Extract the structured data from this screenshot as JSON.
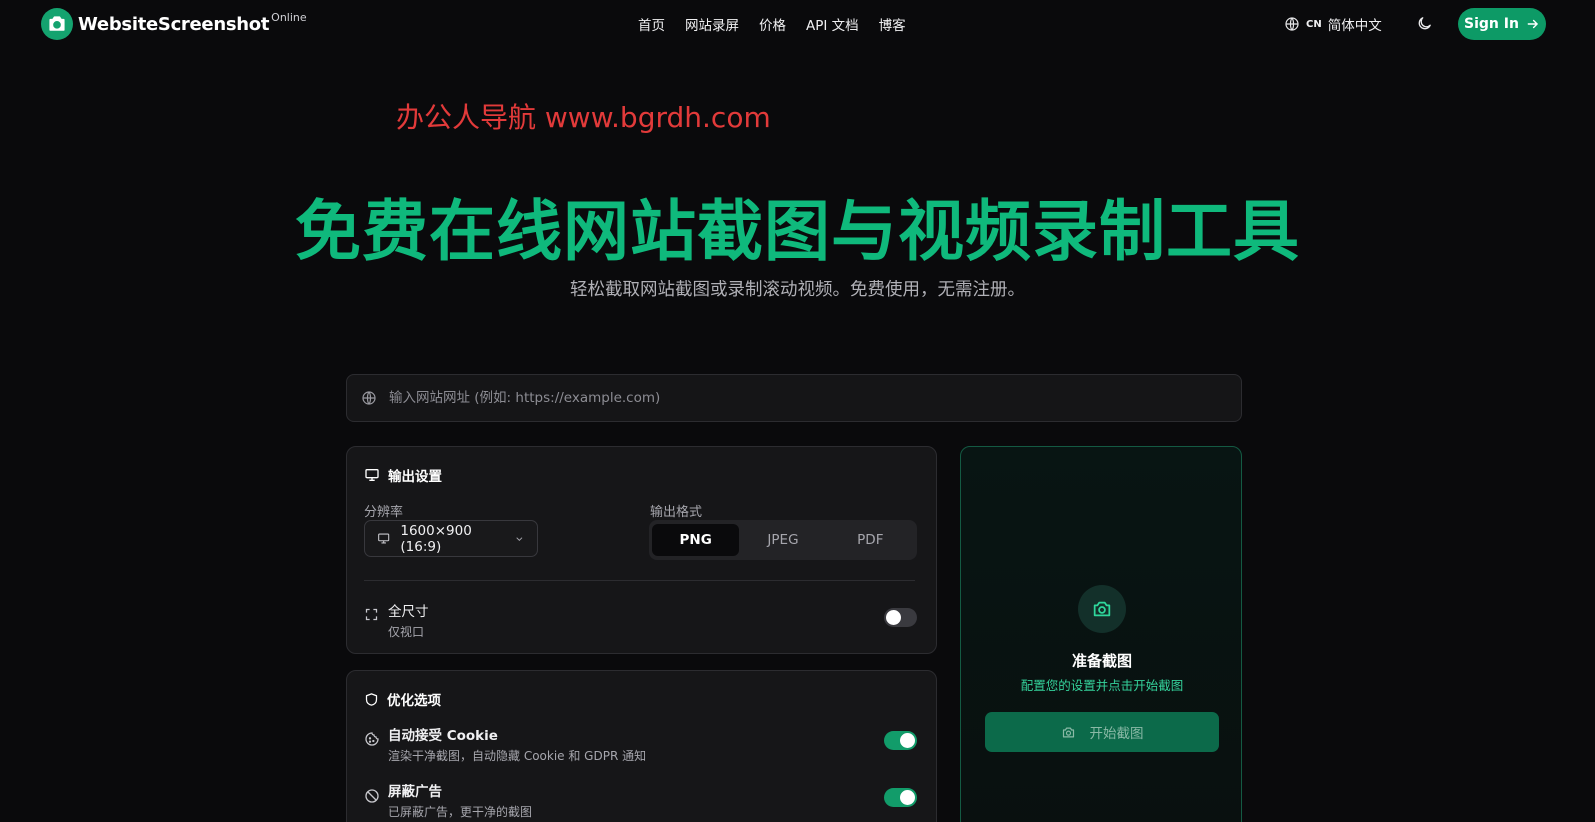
{
  "header": {
    "logo_text": "WebsiteScreenshot",
    "logo_sup": "Online",
    "nav": [
      "首页",
      "网站录屏",
      "价格",
      "API 文档",
      "博客"
    ],
    "lang_code": "CN",
    "lang_label": "简体中文",
    "signin_label": "Sign In"
  },
  "watermark": "办公人导航 www.bgrdh.com",
  "hero": {
    "title": "免费在线网站截图与视频录制工具",
    "subtitle": "轻松截取网站截图或录制滚动视频。免费使用，无需注册。"
  },
  "url_input": {
    "placeholder": "输入网站网址 (例如: https://example.com)",
    "value": ""
  },
  "output_settings": {
    "title": "输出设置",
    "resolution_label": "分辨率",
    "resolution_value": "1600×900 (16:9)",
    "format_label": "输出格式",
    "formats": [
      "PNG",
      "JPEG",
      "PDF"
    ],
    "selected_format": "PNG",
    "fullsize_title": "全尺寸",
    "fullsize_desc": "仅视口",
    "fullsize_enabled": false
  },
  "optimization": {
    "title": "优化选项",
    "cookie_title": "自动接受 Cookie",
    "cookie_desc": "渲染干净截图，自动隐藏 Cookie 和 GDPR 通知",
    "cookie_enabled": true,
    "ads_title": "屏蔽广告",
    "ads_desc": "已屏蔽广告，更干净的截图",
    "ads_enabled": true
  },
  "preview": {
    "title": "准备截图",
    "subtitle": "配置您的设置并点击开始截图",
    "button_label": "开始截图"
  },
  "colors": {
    "accent": "#0fb97c",
    "button": "#0d9a66",
    "background": "#0a0a0c",
    "watermark": "#e23a3a"
  }
}
